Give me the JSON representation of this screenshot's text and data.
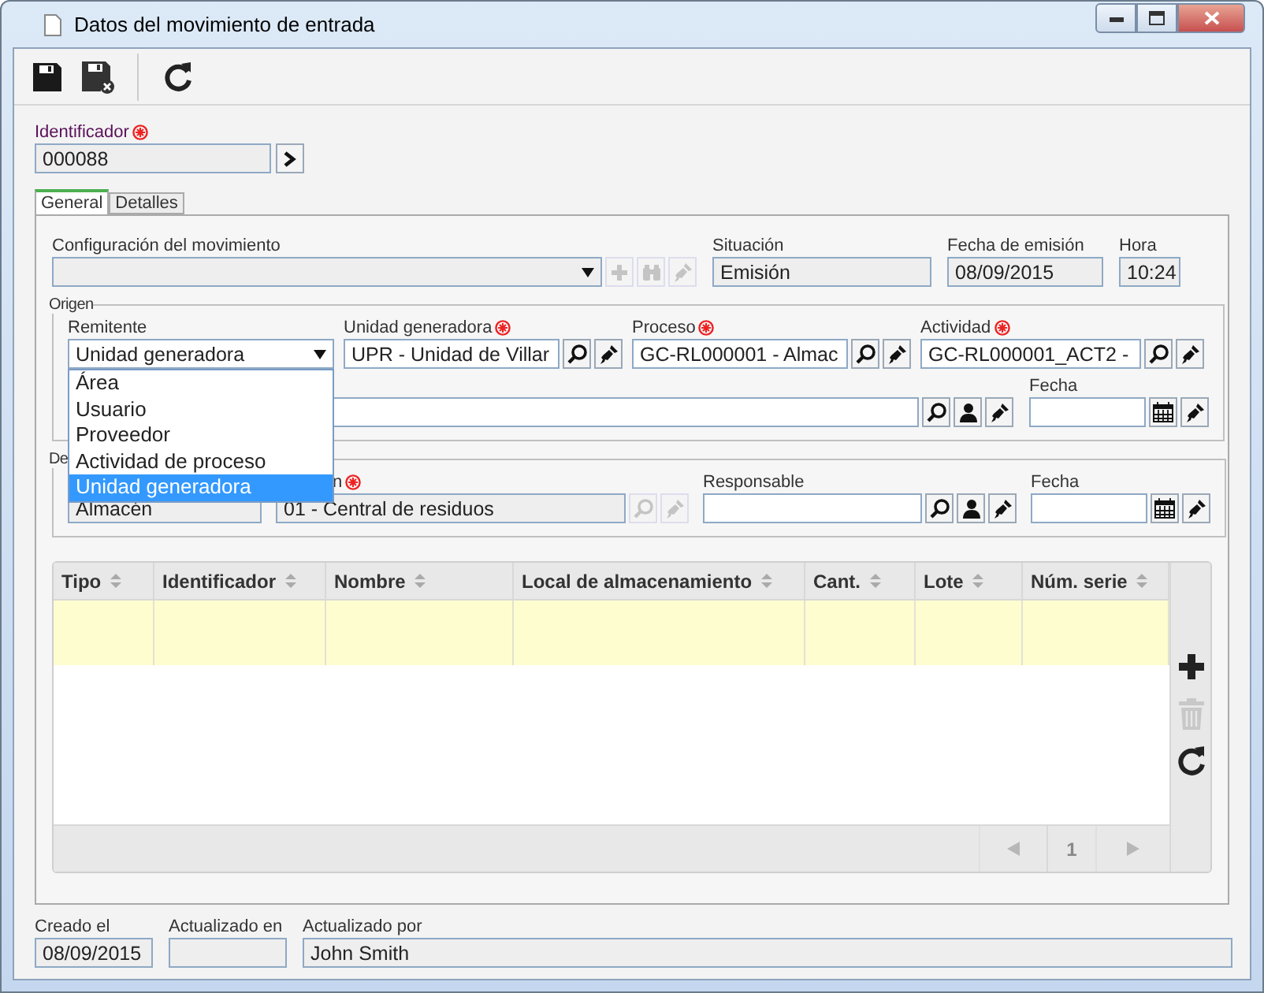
{
  "window": {
    "title": "Datos del movimiento de entrada"
  },
  "toolbar": [
    {
      "kind": "save"
    },
    {
      "kind": "save_close"
    },
    {
      "kind": "refresh"
    }
  ],
  "identifier": {
    "label": "Identificador",
    "required": true,
    "value": "000088",
    "readonly": true
  },
  "tabs": [
    {
      "label": "General",
      "selected": true
    },
    {
      "label": "Detalles",
      "selected": false
    }
  ],
  "general_row": [
    {
      "label": "Configuración del movimiento",
      "kind": "select",
      "readonly": true,
      "buttons": [
        {
          "kind": "add",
          "disabled": true
        },
        {
          "kind": "binoculars",
          "disabled": true
        },
        {
          "kind": "clear",
          "disabled": true
        }
      ]
    },
    {
      "label": "Situación",
      "value": "Emisión",
      "readonly": true
    },
    {
      "label": "Fecha de emisión",
      "value": "08/09/2015",
      "readonly": true
    },
    {
      "label": "Hora",
      "value": "10:24",
      "readonly": true
    }
  ],
  "origin": {
    "legend": "Origen",
    "row_1": [
      {
        "label": "Remitente",
        "kind": "select",
        "value": "Unidad generadora",
        "expanded": true,
        "options": [
          {
            "label": "Área",
            "selected": false
          },
          {
            "label": "Usuario",
            "selected": false
          },
          {
            "label": "Proveedor",
            "selected": false
          },
          {
            "label": "Actividad de proceso",
            "selected": false
          },
          {
            "label": "Unidad generadora",
            "selected": true
          }
        ]
      },
      {
        "label": "Unidad generadora",
        "required": true,
        "value": "UPR - Unidad de Villar",
        "buttons": [
          {
            "kind": "search",
            "disabled": false
          },
          {
            "kind": "clear",
            "disabled": false
          }
        ]
      },
      {
        "label": "Proceso",
        "required": true,
        "value": "GC-RL000001 - Almac",
        "buttons": [
          {
            "kind": "search",
            "disabled": false
          },
          {
            "kind": "clear",
            "disabled": false
          }
        ]
      },
      {
        "label": "Actividad",
        "required": true,
        "value": "GC-RL000001_ACT2 -",
        "buttons": [
          {
            "kind": "search",
            "disabled": false
          },
          {
            "kind": "clear",
            "disabled": false
          }
        ]
      }
    ],
    "row_2": [
      {
        "buttons": [
          {
            "kind": "search",
            "disabled": false
          },
          {
            "kind": "user",
            "disabled": false
          },
          {
            "kind": "clear",
            "disabled": false
          }
        ]
      },
      {
        "label": "Fecha",
        "buttons": [
          {
            "kind": "calendar",
            "disabled": false
          },
          {
            "kind": "clear",
            "disabled": false
          }
        ]
      }
    ]
  },
  "destination": {
    "legend": "De",
    "row": [
      {
        "value": "Almacén",
        "readonly": true
      },
      {
        "label": "n",
        "required": true,
        "value": "01 - Central de residuos",
        "readonly": true,
        "buttons": [
          {
            "kind": "search",
            "disabled": true
          },
          {
            "kind": "clear",
            "disabled": true
          }
        ]
      },
      {
        "label": "Responsable",
        "buttons": [
          {
            "kind": "search",
            "disabled": false
          },
          {
            "kind": "user",
            "disabled": false
          },
          {
            "kind": "clear",
            "disabled": false
          }
        ]
      },
      {
        "label": "Fecha",
        "buttons": [
          {
            "kind": "calendar",
            "disabled": false
          },
          {
            "kind": "clear",
            "disabled": false
          }
        ]
      }
    ]
  },
  "table": {
    "columns": [
      "Tipo",
      "Identificador",
      "Nombre",
      "Local de almacenamiento",
      "Cant.",
      "Lote",
      "Núm. serie"
    ],
    "rows": [
      {
        "selected": true
      }
    ],
    "actions": [
      {
        "kind": "add",
        "disabled": false
      },
      {
        "kind": "delete",
        "disabled": true
      },
      {
        "kind": "refresh",
        "disabled": false
      }
    ],
    "pager": {
      "page": "1",
      "prev_disabled": true,
      "next_disabled": true
    }
  },
  "footer": [
    {
      "label": "Creado el",
      "value": "08/09/2015"
    },
    {
      "label": "Actualizado en"
    },
    {
      "label": "Actualizado por",
      "value": "John Smith"
    }
  ]
}
